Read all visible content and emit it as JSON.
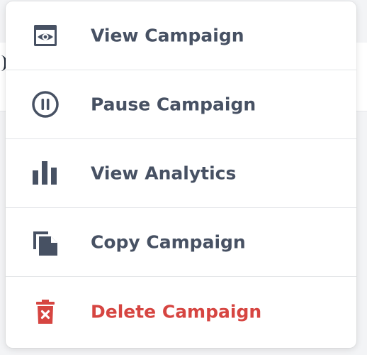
{
  "menu": {
    "items": [
      {
        "label": "View Campaign",
        "icon": "eye-window-icon"
      },
      {
        "label": "Pause Campaign",
        "icon": "pause-circle-icon"
      },
      {
        "label": "View Analytics",
        "icon": "bar-chart-icon"
      },
      {
        "label": "Copy Campaign",
        "icon": "copy-icon"
      },
      {
        "label": "Delete Campaign",
        "icon": "trash-icon"
      }
    ]
  },
  "colors": {
    "text": "#475163",
    "icon": "#475163",
    "danger": "#d64541",
    "divider": "#e3e5e8"
  }
}
